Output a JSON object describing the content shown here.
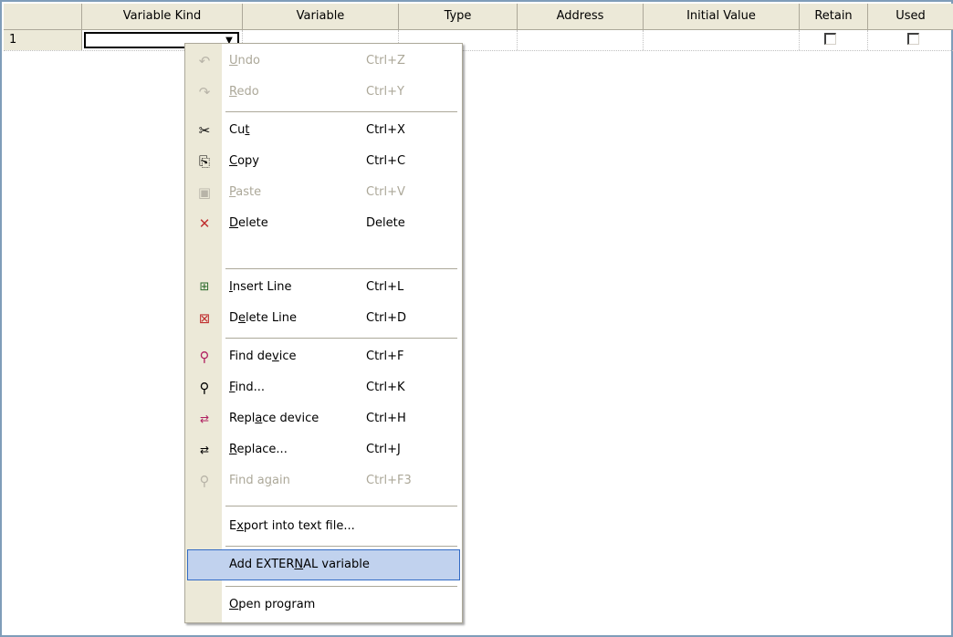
{
  "columns": [
    "Variable Kind",
    "Variable",
    "Type",
    "Address",
    "Initial Value",
    "Retain",
    "Used"
  ],
  "rows": [
    {
      "number": "1",
      "variable_kind": "",
      "variable": "",
      "type": "",
      "address": "",
      "initial_value": "",
      "retain": false,
      "used": false
    }
  ],
  "menu": {
    "items": [
      {
        "pre": "",
        "ul": "U",
        "post": "ndo",
        "shortcut": "Ctrl+Z",
        "icon": "undo-icon",
        "enabled": false
      },
      {
        "pre": "",
        "ul": "R",
        "post": "edo",
        "shortcut": "Ctrl+Y",
        "icon": "redo-icon",
        "enabled": false
      },
      {
        "pre": "Cu",
        "ul": "t",
        "post": "",
        "shortcut": "Ctrl+X",
        "icon": "cut-icon",
        "enabled": true
      },
      {
        "pre": "",
        "ul": "C",
        "post": "opy",
        "shortcut": "Ctrl+C",
        "icon": "copy-icon",
        "enabled": true
      },
      {
        "pre": "",
        "ul": "P",
        "post": "aste",
        "shortcut": "Ctrl+V",
        "icon": "paste-icon",
        "enabled": false
      },
      {
        "pre": "",
        "ul": "D",
        "post": "elete",
        "shortcut": "Delete",
        "icon": "delete-icon",
        "enabled": true
      },
      {
        "pre": "",
        "ul": "I",
        "post": "nsert Line",
        "shortcut": "Ctrl+L",
        "icon": "insert-line-icon",
        "enabled": true
      },
      {
        "pre": "D",
        "ul": "e",
        "post": "lete Line",
        "shortcut": "Ctrl+D",
        "icon": "delete-line-icon",
        "enabled": true
      },
      {
        "pre": "Find de",
        "ul": "v",
        "post": "ice",
        "shortcut": "Ctrl+F",
        "icon": "find-device-icon",
        "enabled": true
      },
      {
        "pre": "",
        "ul": "F",
        "post": "ind...",
        "shortcut": "Ctrl+K",
        "icon": "find-icon",
        "enabled": true
      },
      {
        "pre": "Repl",
        "ul": "a",
        "post": "ce device",
        "shortcut": "Ctrl+H",
        "icon": "replace-device-icon",
        "enabled": true
      },
      {
        "pre": "",
        "ul": "R",
        "post": "eplace...",
        "shortcut": "Ctrl+J",
        "icon": "replace-icon",
        "enabled": true
      },
      {
        "pre": "Find a",
        "ul": "g",
        "post": "ain",
        "shortcut": "Ctrl+F3",
        "icon": "find-again-icon",
        "enabled": false
      },
      {
        "pre": "E",
        "ul": "x",
        "post": "port into text file...",
        "shortcut": "",
        "icon": "",
        "enabled": true
      },
      {
        "pre": "Add EXTER",
        "ul": "N",
        "post": "AL variable",
        "shortcut": "",
        "icon": "",
        "enabled": true,
        "highlighted": true
      },
      {
        "pre": "",
        "ul": "O",
        "post": "pen program",
        "shortcut": "",
        "icon": "",
        "enabled": true
      }
    ]
  }
}
